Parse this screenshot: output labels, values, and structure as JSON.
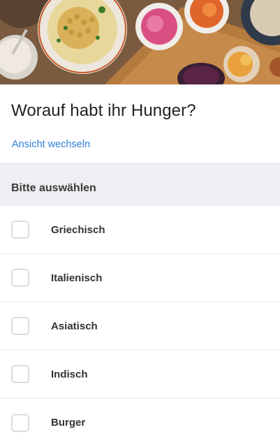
{
  "hero": {
    "image": "food-table-photo"
  },
  "header": {
    "title": "Worauf habt ihr Hunger?",
    "switch_view_label": "Ansicht wechseln"
  },
  "section": {
    "label": "Bitte auswählen"
  },
  "options": [
    {
      "label": "Griechisch",
      "checked": false
    },
    {
      "label": "Italienisch",
      "checked": false
    },
    {
      "label": "Asiatisch",
      "checked": false
    },
    {
      "label": "Indisch",
      "checked": false
    },
    {
      "label": "Burger",
      "checked": false
    }
  ],
  "colors": {
    "link": "#2f80d8",
    "section_bg": "#efeff3",
    "checkbox_border": "#dcdcdc"
  }
}
